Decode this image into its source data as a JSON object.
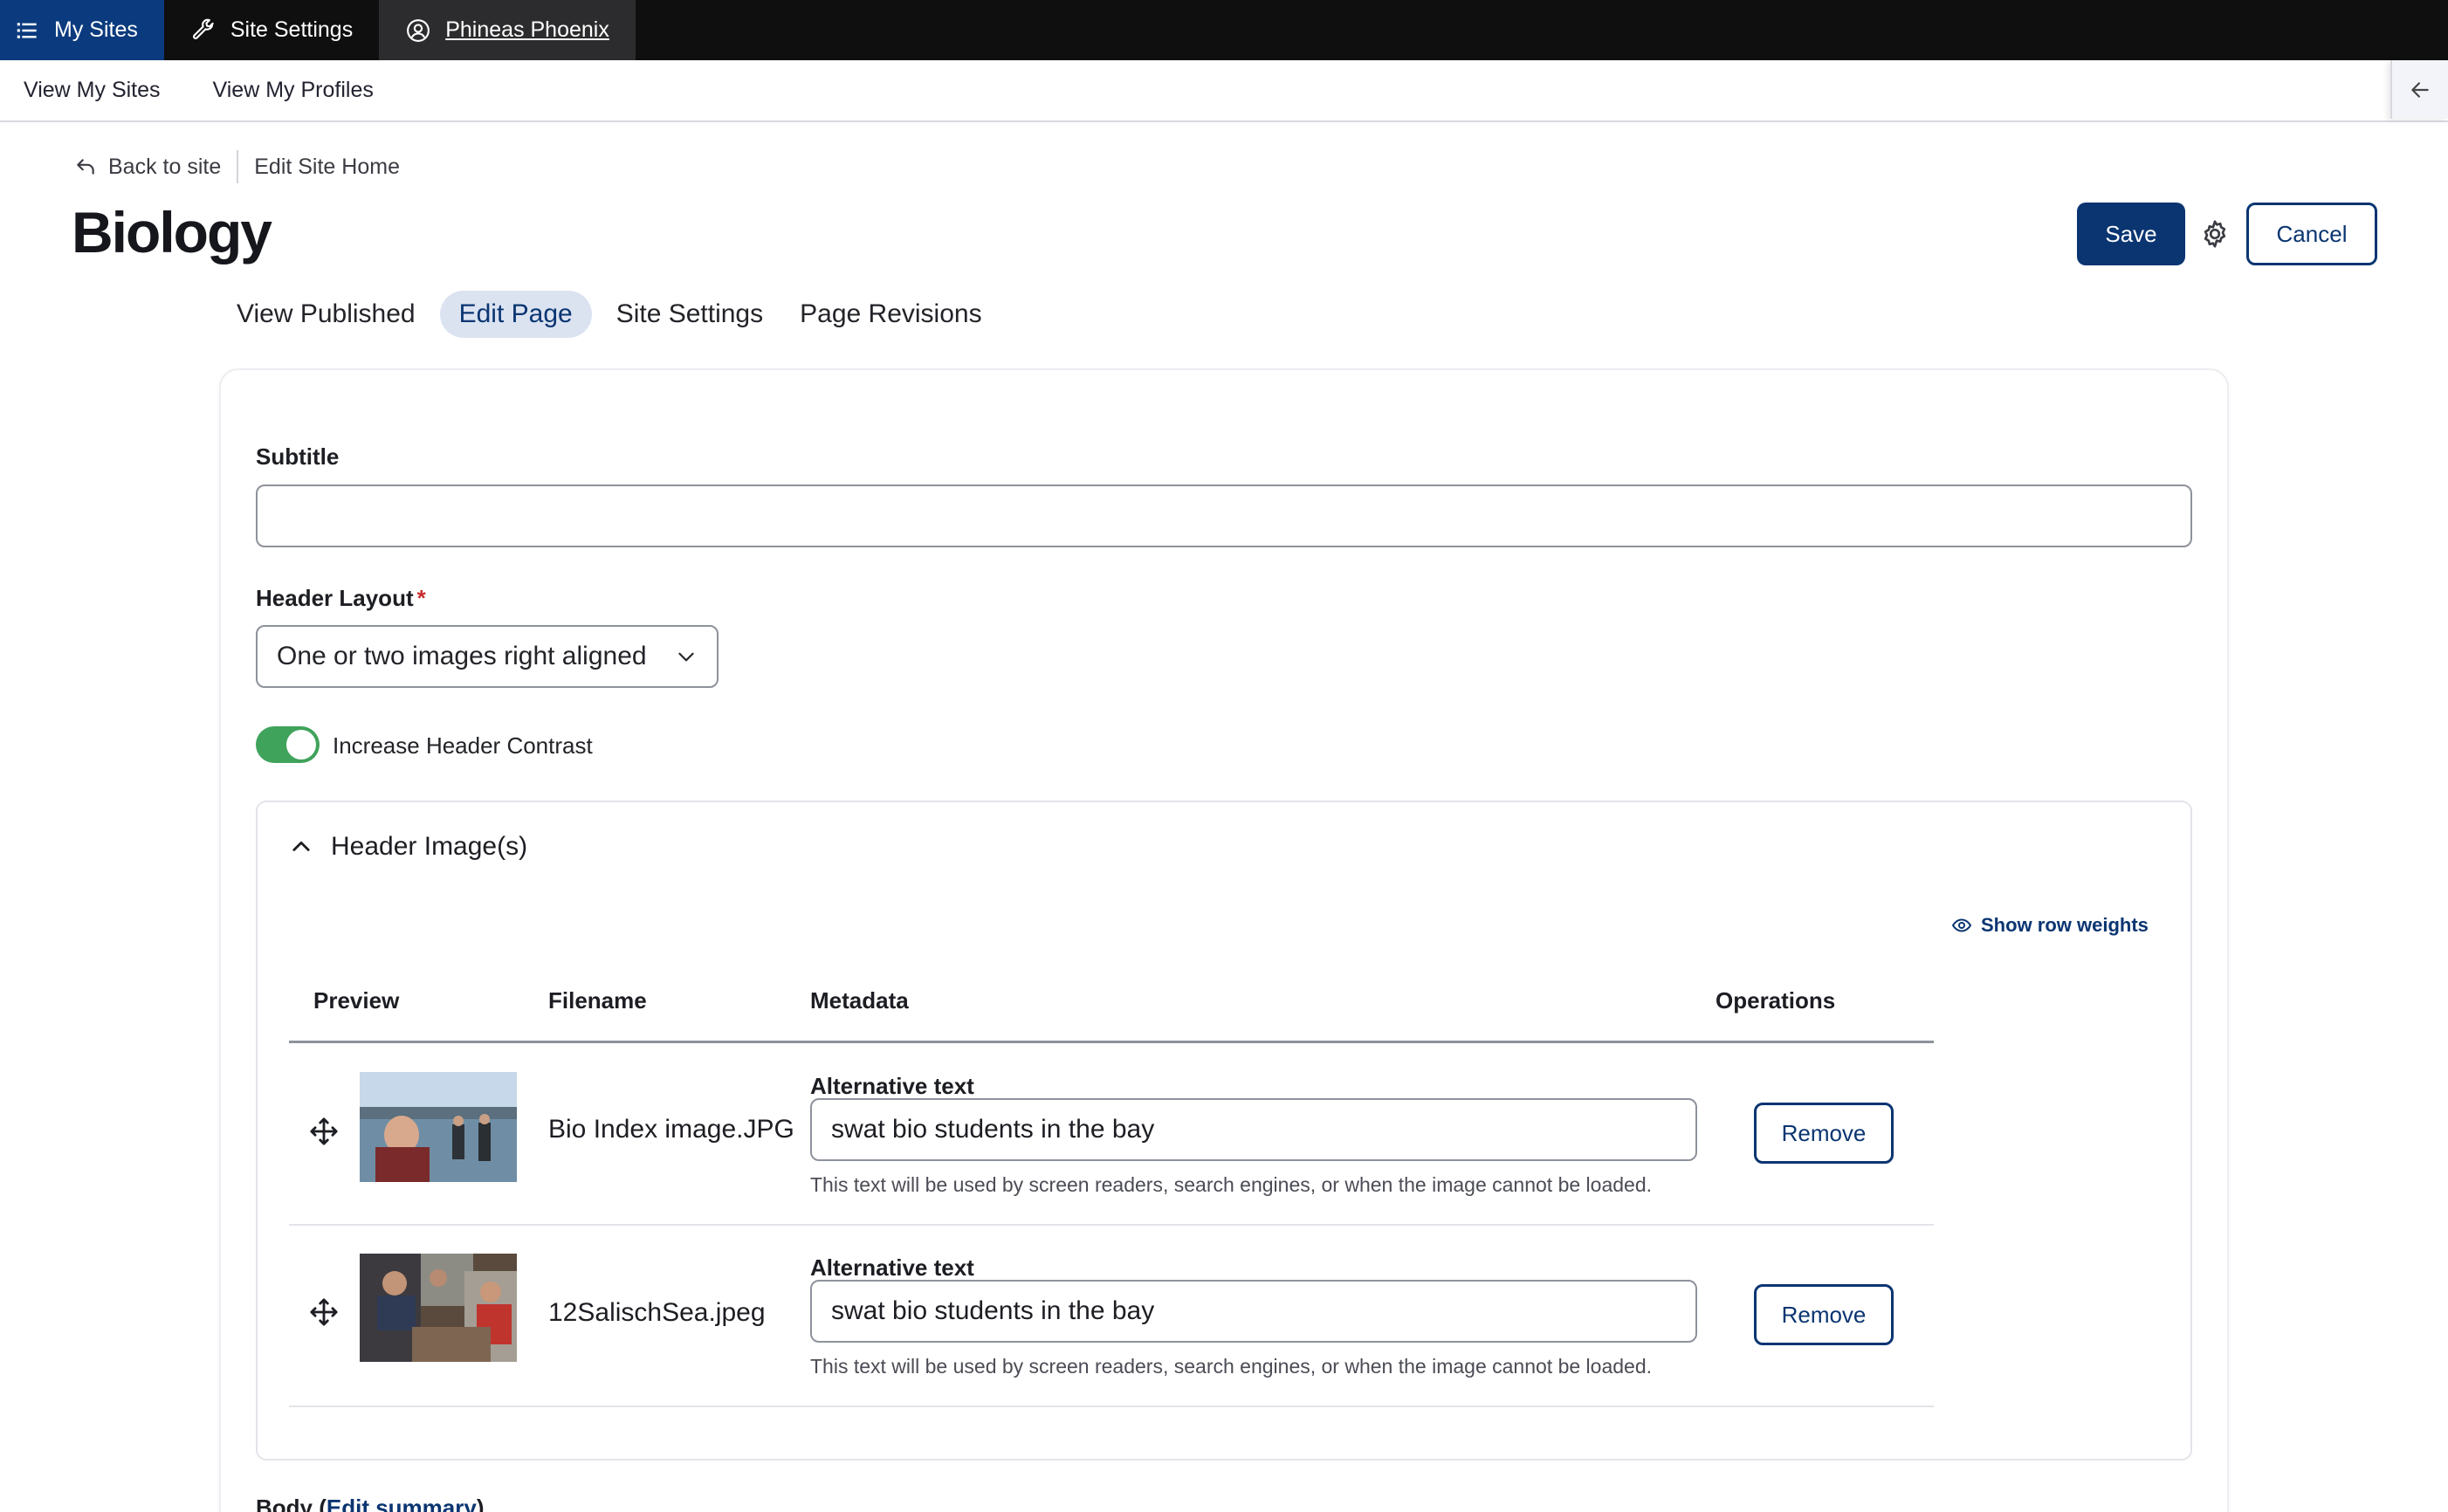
{
  "toolbar": {
    "my_sites": "My Sites",
    "site_settings": "Site Settings",
    "user_name": "Phineas Phoenix"
  },
  "tray": {
    "view_my_sites": "View My Sites",
    "view_my_profiles": "View My Profiles"
  },
  "header": {
    "back_to_site": "Back to site",
    "breadcrumb_current": "Edit Site Home",
    "title": "Biology",
    "save_label": "Save",
    "cancel_label": "Cancel"
  },
  "tabs": [
    {
      "label": "View Published",
      "active": false
    },
    {
      "label": "Edit Page",
      "active": true
    },
    {
      "label": "Site Settings",
      "active": false
    },
    {
      "label": "Page Revisions",
      "active": false
    }
  ],
  "form": {
    "subtitle_label": "Subtitle",
    "subtitle_value": "",
    "header_layout_label": "Header Layout",
    "header_layout_required_mark": "*",
    "header_layout_value": "One or two images right aligned",
    "contrast_toggle_on": true,
    "contrast_label": "Increase Header Contrast",
    "header_images": {
      "summary": "Header Image(s)",
      "show_row_weights": "Show row weights",
      "columns": [
        "Preview",
        "Filename",
        "Metadata",
        "Operations"
      ],
      "rows": [
        {
          "filename": "Bio Index image.JPG",
          "alt_label": "Alternative text",
          "alt_value": "swat bio students in the bay",
          "help": "This text will be used by screen readers, search engines, or when the image cannot be loaded.",
          "remove_label": "Remove"
        },
        {
          "filename": "12SalischSea.jpeg",
          "alt_label": "Alternative text",
          "alt_value": "swat bio students in the bay",
          "help": "This text will be used by screen readers, search engines, or when the image cannot be loaded.",
          "remove_label": "Remove"
        }
      ]
    },
    "body_label_prefix": "Body (",
    "body_edit_summary": "Edit summary",
    "body_label_suffix": ")"
  },
  "colors": {
    "toolbar_bg": "#0f0f0f",
    "toolbar_active": "#0b3b7e",
    "primary": "#0a3571",
    "toggle_on": "#3fa35b",
    "tab_active_bg": "#dbe3f1"
  }
}
